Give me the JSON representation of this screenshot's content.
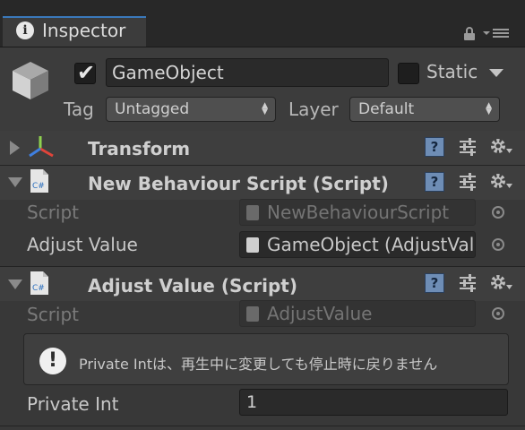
{
  "tab": {
    "title": "Inspector",
    "info_glyph": "i",
    "icons": [
      "lock-icon",
      "menu-icon"
    ]
  },
  "header": {
    "active": true,
    "name": "GameObject",
    "static_label": "Static",
    "static_checked": false,
    "tag_label": "Tag",
    "tag_value": "Untagged",
    "layer_label": "Layer",
    "layer_value": "Default"
  },
  "components": [
    {
      "title": "Transform",
      "expanded": false,
      "icon": "transform-axes-icon"
    },
    {
      "title": "New Behaviour Script (Script)",
      "expanded": true,
      "icon": "csharp-script-icon",
      "properties": [
        {
          "label": "Script",
          "value": "NewBehaviourScript",
          "disabled": true
        },
        {
          "label": "Adjust Value",
          "value": "GameObject (AdjustValue)",
          "disabled": false
        }
      ]
    },
    {
      "title": "Adjust Value (Script)",
      "expanded": true,
      "icon": "csharp-script-icon",
      "properties": [
        {
          "label": "Script",
          "value": "AdjustValue",
          "disabled": true
        },
        {
          "label": "Private Int",
          "value": "1"
        }
      ],
      "helpbox": {
        "glyph": "!",
        "text": "Private Intは、再生中に変更しても停止時に戻りません"
      }
    }
  ],
  "component_tool_glyphs": {
    "help": "?",
    "cs_label": "C#"
  },
  "colors": {
    "background": "#383838",
    "tab_accent": "#3a79bb",
    "help_icon": "#6e8db5",
    "axis_x": "#e0443a",
    "axis_y": "#8fd14f",
    "axis_z": "#3f7fe0"
  }
}
